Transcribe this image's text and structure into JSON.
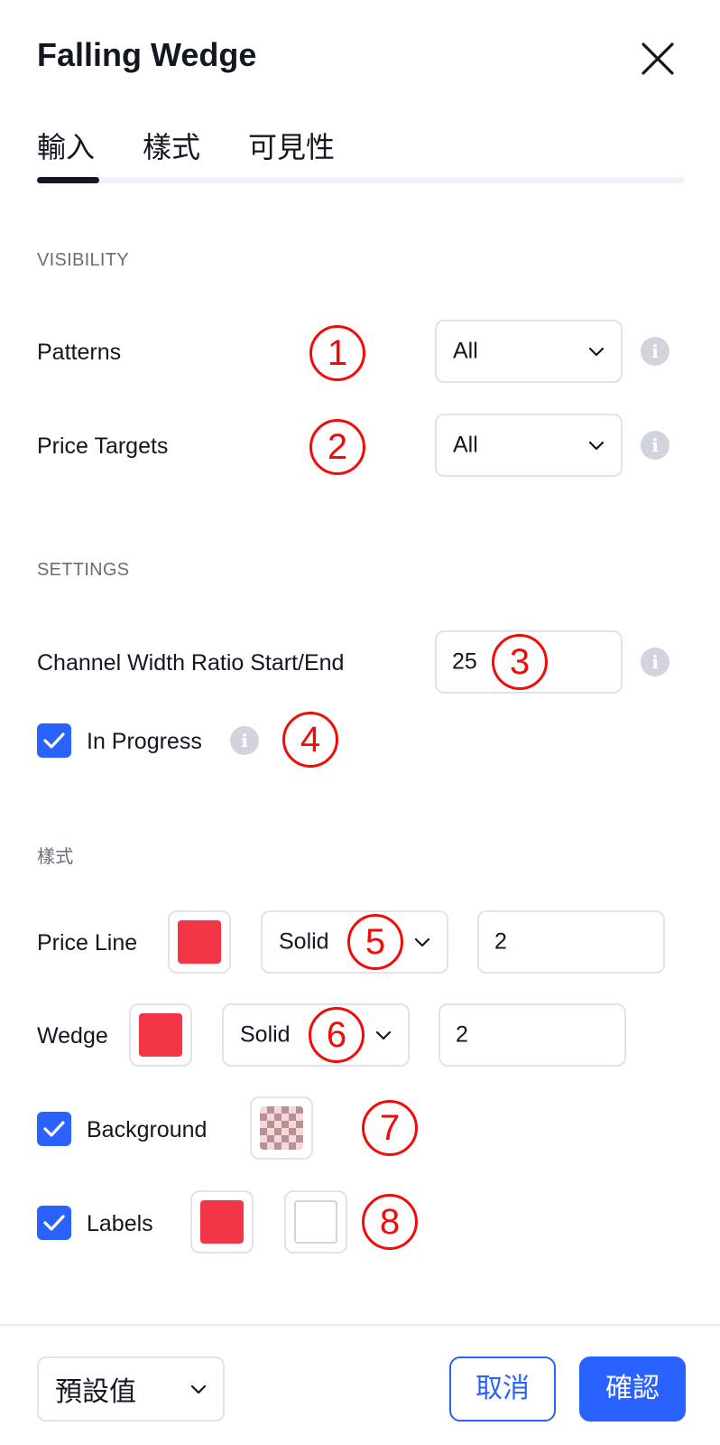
{
  "dialog": {
    "title": "Falling Wedge",
    "close_icon": "close-icon"
  },
  "tabs": [
    {
      "label": "輸入",
      "active": true
    },
    {
      "label": "樣式",
      "active": false
    },
    {
      "label": "可見性",
      "active": false
    }
  ],
  "visibility": {
    "heading": "VISIBILITY",
    "patterns": {
      "label": "Patterns",
      "value": "All",
      "marker": "1"
    },
    "price_targets": {
      "label": "Price Targets",
      "value": "All",
      "marker": "2"
    }
  },
  "settings": {
    "heading": "SETTINGS",
    "channel_width": {
      "label": "Channel Width Ratio Start/End",
      "value": "25",
      "marker": "3"
    },
    "in_progress": {
      "label": "In Progress",
      "checked": true,
      "marker": "4"
    }
  },
  "style": {
    "heading": "樣式",
    "price_line": {
      "label": "Price Line",
      "color": "#f23645",
      "line_style": "Solid",
      "width": "2",
      "marker": "5"
    },
    "wedge": {
      "label": "Wedge",
      "color": "#f23645",
      "line_style": "Solid",
      "width": "2",
      "marker": "6"
    },
    "background": {
      "label": "Background",
      "checked": true,
      "swatch": "transparent-checker",
      "marker": "7"
    },
    "labels": {
      "label": "Labels",
      "checked": true,
      "color": "#f23645",
      "text_color": "#ffffff",
      "marker": "8"
    }
  },
  "footer": {
    "preset_value": "預設值",
    "cancel_label": "取消",
    "ok_label": "確認"
  },
  "colors": {
    "accent": "#2962ff",
    "swatch_red": "#f23645",
    "marker_red": "#f50a0a"
  }
}
